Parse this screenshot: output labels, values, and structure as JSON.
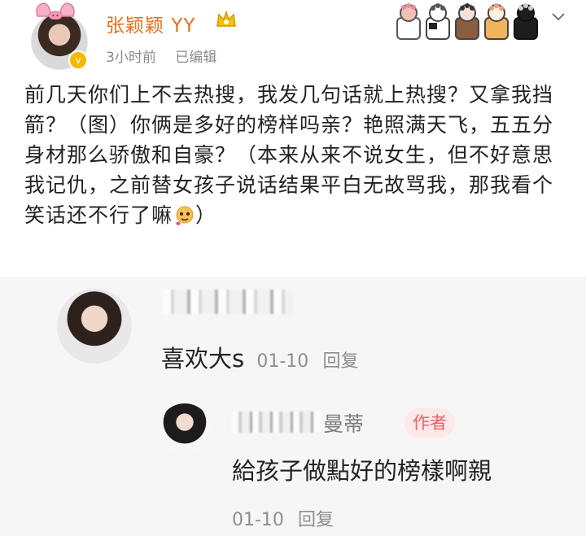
{
  "post": {
    "author": "张颖颖",
    "author_suffix": "YY",
    "time": "3小时前",
    "edited": "已编辑",
    "body": "前几天你们上不去热搜，我发几句话就上热搜？又拿我挡箭？（图）你俩是多好的榜样吗亲？艳照满天飞，五五分身材那么骄傲和自豪？（本来从来不说女生，但不好意思我记仇，之前替女孩子说话结果平白无故骂我，那我看个笑话还不行了嘛",
    "body_end": "）"
  },
  "comment": {
    "text": "喜欢大s",
    "date": "01-10",
    "reply_label": "回复"
  },
  "reply": {
    "name_visible": "曼蒂",
    "author_badge": "作者",
    "text": "給孩子做點好的榜樣啊親",
    "date": "01-10",
    "reply_label": "回复"
  },
  "icons": {
    "header_paws": "cat-paw-icons",
    "more": "chevron-down-icon",
    "vip": "crown-icon",
    "emoji": "blushing-emoji-icon"
  },
  "colors": {
    "author_name": "#e2711d",
    "author_badge_bg": "#fde8ea",
    "author_badge_text": "#ef5c6b",
    "comment_bg": "#f6f6f6"
  }
}
